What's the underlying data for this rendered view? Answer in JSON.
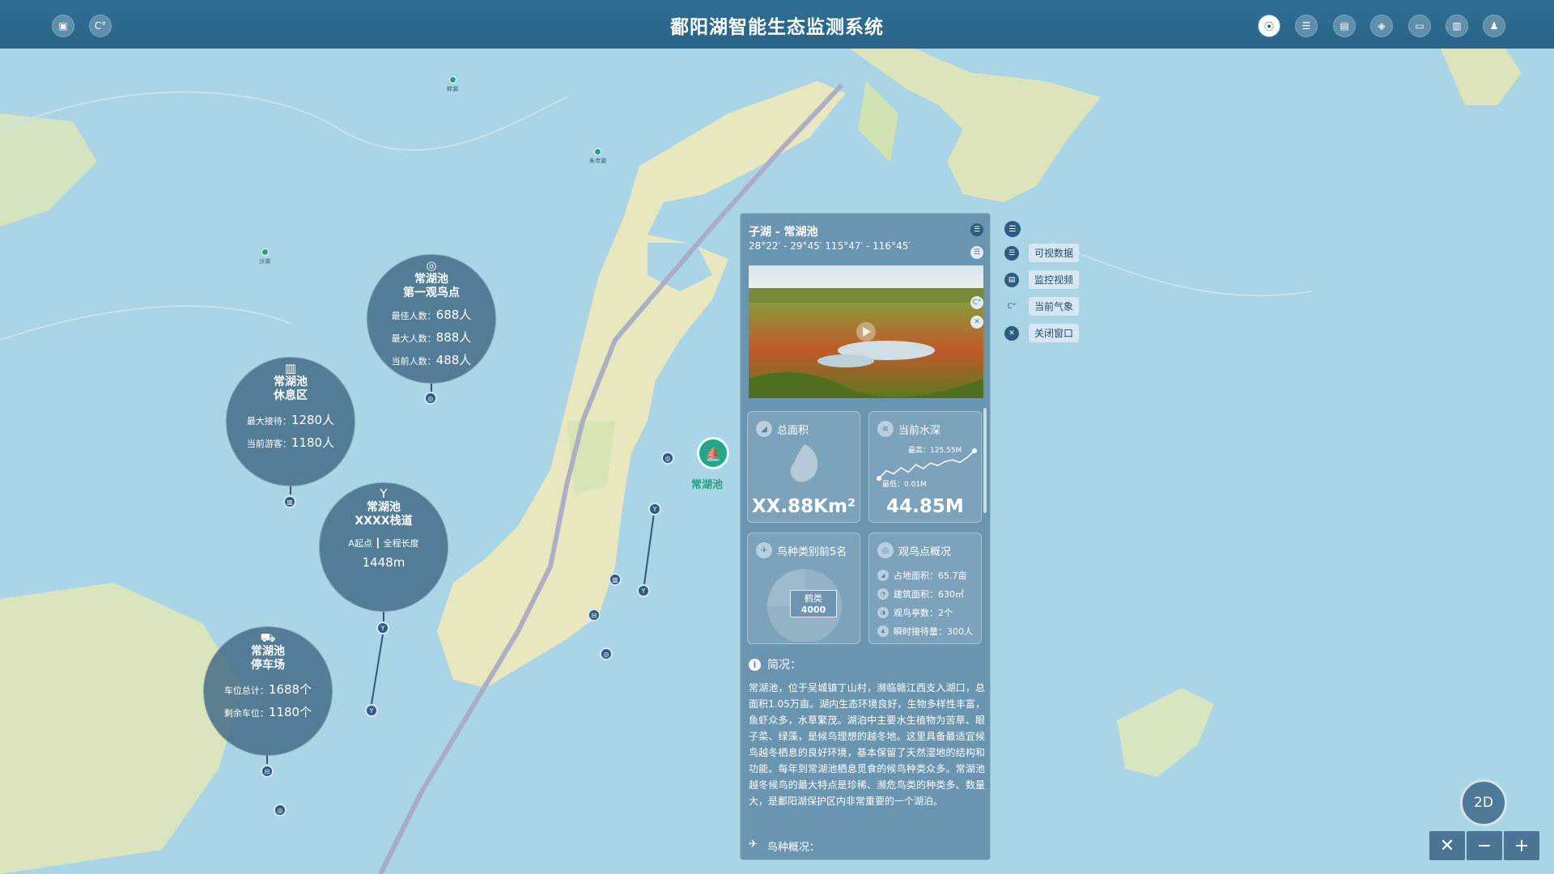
{
  "header": {
    "title": "鄱阳湖智能生态监测系统",
    "left_buttons": [
      {
        "name": "doc-icon",
        "glyph": "▣"
      },
      {
        "name": "weather-icon",
        "glyph": "C°"
      }
    ],
    "right_buttons": [
      {
        "name": "location-icon",
        "glyph": "⦿",
        "active": true
      },
      {
        "name": "database-icon",
        "glyph": "☰"
      },
      {
        "name": "report-icon",
        "glyph": "▤"
      },
      {
        "name": "layers-icon",
        "glyph": "◈"
      },
      {
        "name": "monitor-icon",
        "glyph": "▭"
      },
      {
        "name": "message-icon",
        "glyph": "▥"
      },
      {
        "name": "user-icon",
        "glyph": "♟"
      }
    ]
  },
  "map": {
    "pois": [
      {
        "label": "蚌湖"
      },
      {
        "label": "朱市湖"
      },
      {
        "label": "沙湖"
      }
    ],
    "marker_label": "常湖池"
  },
  "bubbles": {
    "watch_point": {
      "title1": "常湖池",
      "title2": "第一观鸟点",
      "rows": [
        {
          "k": "最佳人数：",
          "v": "688人"
        },
        {
          "k": "最大人数：",
          "v": "888人"
        },
        {
          "k": "当前人数：",
          "v": "488人"
        }
      ]
    },
    "rest_area": {
      "title1": "常湖池",
      "title2": "休息区",
      "rows": [
        {
          "k": "最大接待：",
          "v": "1280人"
        },
        {
          "k": "当前游客：",
          "v": "1180人"
        }
      ]
    },
    "trail": {
      "title1": "常湖池",
      "title2": "XXXX栈道",
      "sub_a": "A起点",
      "sub_b": "全程长度",
      "value": "1448m"
    },
    "parking": {
      "title1": "常湖池",
      "title2": "停车场",
      "rows": [
        {
          "k": "车位总计：",
          "v": "1688个"
        },
        {
          "k": "剩余车位：",
          "v": "1180个"
        }
      ]
    }
  },
  "panel": {
    "title": "子湖 - 常湖池",
    "coords": "28°22′ - 29°45′  115°47′ - 116°45′",
    "area": {
      "label": "总面积",
      "value": "XX.88Km²"
    },
    "depth": {
      "label": "当前水深",
      "value": "44.85M",
      "max": "最高：125.55M",
      "min": "最低：0.01M",
      "curve": [
        0.1,
        0.35,
        0.25,
        0.45,
        0.3,
        0.55,
        0.42,
        0.6,
        0.52,
        0.65,
        0.7,
        0.62,
        0.78,
        1.0
      ]
    },
    "birds": {
      "label": "鸟种类别前5名",
      "top_name": "鹤类",
      "top_value": "4000"
    },
    "obs": {
      "label": "观鸟点概况",
      "items": [
        {
          "text": "占地面积：65.7亩"
        },
        {
          "text": "建筑面积：630㎡"
        },
        {
          "text": "观鸟亭数：2个"
        },
        {
          "text": "瞬时接待量：300人"
        }
      ]
    },
    "intro_title": "简况：",
    "intro_text": "常湖池，位于吴城镇丁山村，濒临赣江西支入湖口，总面积1.05万亩。湖内生态环境良好，生物多样性丰富，鱼虾众多，水草繁茂。湖泊中主要水生植物为苦草、眼子菜、绿藻，是候鸟理想的越冬地。这里具备最适宜候鸟越冬栖息的良好环境，基本保留了天然湿地的结构和功能。每年到常湖池栖息觅食的候鸟种类众多。常湖池越冬候鸟的最大特点是珍稀、濒危鸟类的种类多、数量大，是鄱阳湖保护区内非常重要的一个湖泊。",
    "bird_section": "鸟种概况："
  },
  "side_menu": {
    "items": [
      {
        "label": "可视数据",
        "glyph": "☰"
      },
      {
        "label": "监控视频",
        "glyph": "▤"
      },
      {
        "label": "当前气象",
        "glyph": "C°"
      },
      {
        "label": "关闭窗口",
        "glyph": "✕"
      }
    ]
  },
  "controls": {
    "mode": "2D",
    "zoom_out": "−",
    "zoom_in": "+",
    "tools": "✕"
  },
  "colors": {
    "header": "#2a6488",
    "accent": "#25a58a",
    "water": "#a9d5e6",
    "land": "#e9e7bf"
  }
}
